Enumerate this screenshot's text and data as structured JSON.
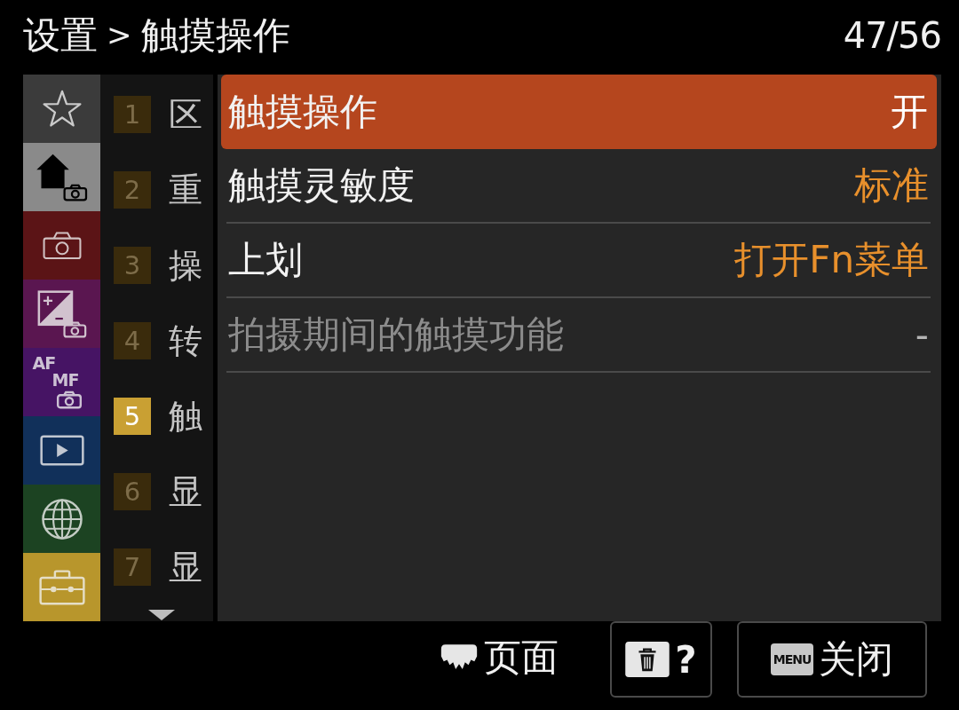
{
  "header": {
    "parent": "设置",
    "separator": ">",
    "title": "触摸操作",
    "page_counter": "47/56"
  },
  "category_tabs": [
    {
      "kind": "star",
      "selected": false,
      "color": "#3b3b3b"
    },
    {
      "kind": "home_camera",
      "selected": true,
      "color": "#8a8a8a"
    },
    {
      "kind": "camera",
      "selected": false,
      "color": "#5b1416"
    },
    {
      "kind": "exposure_camera",
      "selected": false,
      "color": "#5a1650"
    },
    {
      "kind": "af_mf_camera",
      "selected": false,
      "color": "#461464",
      "texts": [
        "AF",
        "MF"
      ]
    },
    {
      "kind": "playback",
      "selected": false,
      "color": "#11305a"
    },
    {
      "kind": "globe",
      "selected": false,
      "color": "#1c4322"
    },
    {
      "kind": "toolbox",
      "selected": false,
      "color": "#b8962c"
    }
  ],
  "pages": [
    {
      "number": "1",
      "label": "区",
      "selected": false
    },
    {
      "number": "2",
      "label": "重",
      "selected": false
    },
    {
      "number": "3",
      "label": "操",
      "selected": false
    },
    {
      "number": "4",
      "label": "转",
      "selected": false
    },
    {
      "number": "5",
      "label": "触",
      "selected": true
    },
    {
      "number": "6",
      "label": "显",
      "selected": false
    },
    {
      "number": "7",
      "label": "显",
      "selected": false
    }
  ],
  "settings": [
    {
      "label": "触摸操作",
      "value": "开",
      "selected": true,
      "disabled": false
    },
    {
      "label": "触摸灵敏度",
      "value": "标准",
      "selected": false,
      "disabled": false
    },
    {
      "label": "上划",
      "value": "打开Fn菜单",
      "selected": false,
      "disabled": false
    },
    {
      "label": "拍摄期间的触摸功能",
      "value": "-",
      "selected": false,
      "disabled": true
    }
  ],
  "footer": {
    "page_hint": "页面",
    "help_label": "?",
    "menu_key": "MENU",
    "close_label": "关闭"
  }
}
